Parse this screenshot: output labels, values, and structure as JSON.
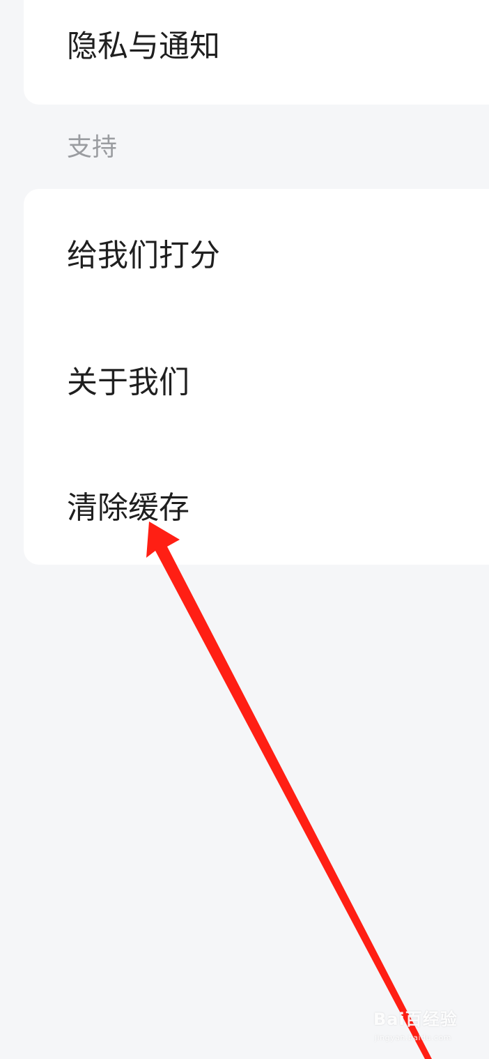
{
  "settings": {
    "top_group": {
      "items": [
        {
          "label": "隐私与通知"
        }
      ]
    },
    "support_group": {
      "section_title": "支持",
      "items": [
        {
          "label": "给我们打分"
        },
        {
          "label": "关于我们"
        },
        {
          "label": "清除缓存"
        }
      ]
    }
  },
  "overlay": {
    "annotation_color": "#ff1f14",
    "watermark": {
      "main": "Bai百经验",
      "sub": "jingyan.baidu.com"
    }
  },
  "colors": {
    "background": "#f5f6f8",
    "card": "#ffffff",
    "primary_text": "#1f1f1f",
    "secondary_text": "#9a9ca0"
  }
}
